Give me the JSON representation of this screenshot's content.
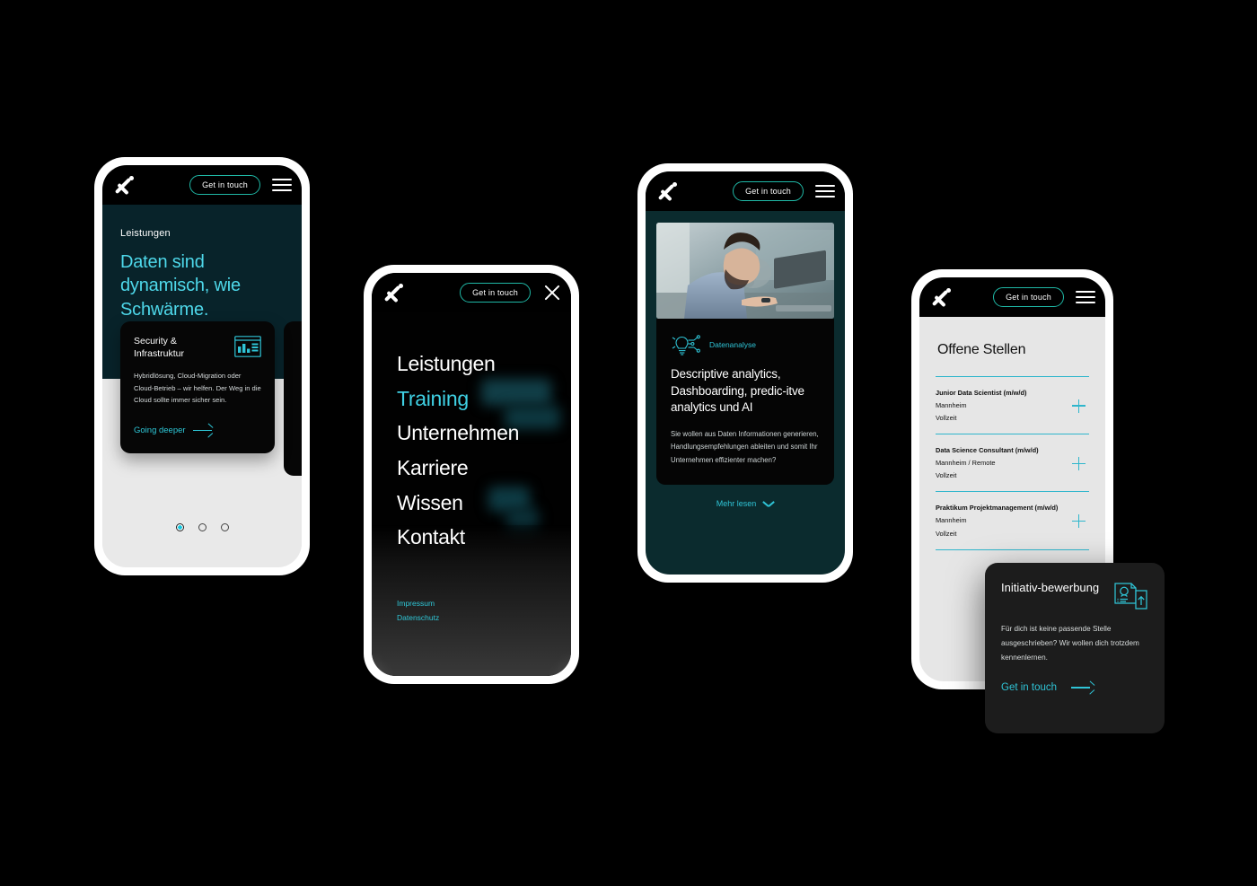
{
  "theme": {
    "background": "#000000",
    "accent_cyan": "#2fc4d6",
    "heading_cyan": "#4ed8ea",
    "dark_teal": "#08232a",
    "card_black": "#060606",
    "light_gray": "#e6e6e6"
  },
  "common": {
    "cta_label": "Get in touch",
    "logo_name": "x-logo",
    "menu_icon": "hamburger-icon",
    "close_icon": "close-icon"
  },
  "phone1": {
    "kicker": "Leistungen",
    "headline": "Daten sind dynamisch, wie Schwärme.",
    "card": {
      "title": "Security & Infrastruktur",
      "icon": "bar-chart-dashboard-icon",
      "body": "Hybridlösung, Cloud-Migration oder Cloud-Betrieb – wir helfen. Der Weg in die Cloud sollte immer sicher sein.",
      "link_label": "Going deeper"
    },
    "carousel": {
      "total": 3,
      "active_index": 0
    }
  },
  "phone2": {
    "menu_items": [
      {
        "label": "Leistungen",
        "active": false
      },
      {
        "label": "Training",
        "active": true
      },
      {
        "label": "Unternehmen",
        "active": false
      },
      {
        "label": "Karriere",
        "active": false
      },
      {
        "label": "Wissen",
        "active": false
      },
      {
        "label": "Kontakt",
        "active": false
      }
    ],
    "legal": [
      {
        "label": "Impressum"
      },
      {
        "label": "Datenschutz"
      }
    ]
  },
  "phone3": {
    "photo_alt": "man-working-on-laptop-photo",
    "tag": "Datenanalyse",
    "tag_icon": "lightbulb-circuit-icon",
    "title": "Descriptive analytics, Dashboarding, predic-itve analytics und AI",
    "body": "Sie wollen aus Daten Informationen generieren, Handlungsempfehlungen ableiten und somit Ihr Unternehmen effizienter machen?",
    "more_label": "Mehr lesen"
  },
  "phone4": {
    "title": "Offene Stellen",
    "jobs": [
      {
        "role": "Junior Data Scientist (m/w/d)",
        "location": "Mannheim",
        "type": "Vollzeit"
      },
      {
        "role": "Data Science Consultant (m/w/d)",
        "location": "Mannheim / Remote",
        "type": "Vollzeit"
      },
      {
        "role": "Praktikum Projektmanagement (m/w/d)",
        "location": "Mannheim",
        "type": "Vollzeit"
      }
    ]
  },
  "initiativ_card": {
    "title": "Initiativ-bewerbung",
    "icon": "document-upload-profile-icon",
    "body": "Für dich ist keine passende Stelle ausgeschrieben? Wir wollen dich trotzdem kennenlernen.",
    "cta_label": "Get in touch"
  }
}
